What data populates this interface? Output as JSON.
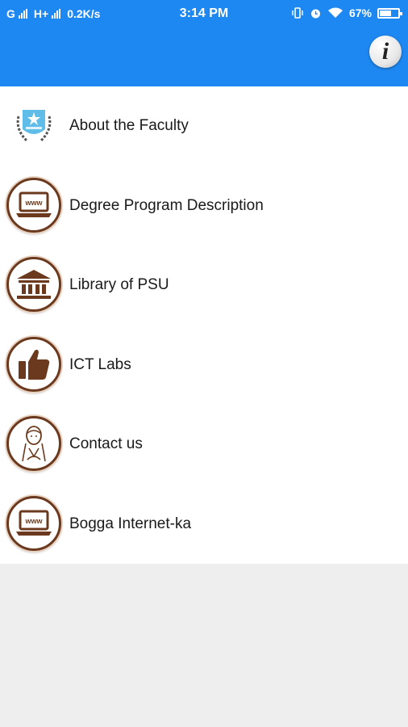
{
  "status_bar": {
    "carrier1": "G",
    "carrier2": "H+",
    "speed": "0.2K/s",
    "time": "3:14 PM",
    "battery": "67%"
  },
  "header": {
    "info_button_label": "i"
  },
  "menu": {
    "items": [
      {
        "label": "About the Faculty",
        "icon": "faculty-crest-icon"
      },
      {
        "label": "Degree Program Description",
        "icon": "www-laptop-icon"
      },
      {
        "label": "Library of PSU",
        "icon": "library-building-icon"
      },
      {
        "label": "ICT Labs",
        "icon": "thumbs-up-icon"
      },
      {
        "label": "Contact us",
        "icon": "contact-person-icon"
      },
      {
        "label": "Bogga Internet-ka",
        "icon": "www-laptop-icon"
      }
    ],
    "laptop_screen_text": "www"
  },
  "colors": {
    "header": "#1e88f2",
    "icon_ring": "#6b3a1e",
    "background": "#eeeeee"
  }
}
